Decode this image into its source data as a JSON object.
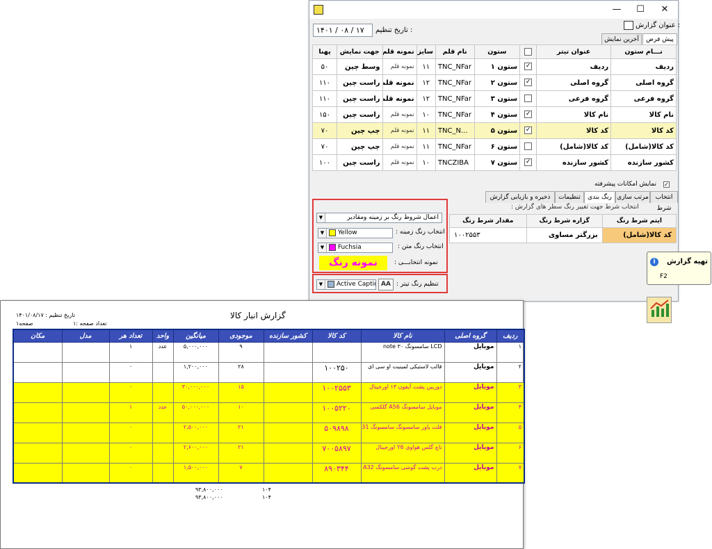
{
  "window": {
    "title": "",
    "controls": {
      "minimize": "—",
      "maximize": "☐",
      "close": "✕"
    },
    "report_title_label": "عنوان گزارش :",
    "date_label": "تاریخ تنظیم :",
    "date_day": "۱۴۰۱",
    "date_month": "/ ۰۸ /",
    "date_year": "۱۷",
    "tabs": {
      "default": "پیش فرض",
      "last": "آخرین نمایش"
    },
    "grid_headers": [
      "نـــام ستون",
      "عنوان تیتر",
      "",
      "ستون",
      "نام قلم",
      "سایز",
      "نمونه قلم",
      "جهت نمایش",
      "پهنا"
    ],
    "grid_rows": [
      {
        "name": "ردیف",
        "title": "ردیف",
        "checked": "✓",
        "col": "ستون ۱",
        "font": "TNC_NFar",
        "size": "۱۱",
        "sample": "نمونه قلم",
        "dir": "وسط چین",
        "width": "۵۰"
      },
      {
        "name": "گروه اصلی",
        "title": "گروه اصلی",
        "checked": "✓",
        "col": "ستون ۲",
        "font": "TNC_NFar",
        "size": "۱۲",
        "sample": "نمونه قلم",
        "dir": "راست چین",
        "width": "۱۱۰"
      },
      {
        "name": "گروه فرعی",
        "title": "گروه فرعی",
        "checked": "",
        "col": "ستون ۳",
        "font": "TNC_NFar",
        "size": "۱۲",
        "sample": "نمونه قلم",
        "dir": "راست چین",
        "width": "۱۱۰"
      },
      {
        "name": "نام کالا",
        "title": "نام کالا",
        "checked": "✓",
        "col": "ستون ۴",
        "font": "TNC_NFar",
        "size": "۱۰",
        "sample": "نمونه قلم",
        "dir": "راست چین",
        "width": "۱۵۰"
      },
      {
        "name": "کد کالا",
        "title": "کد کالا",
        "checked": "✓",
        "col": "ستون ۵",
        "font": "TNC_N...",
        "size": "۱۱",
        "sample": "نمونه قلم",
        "dir": "چپ چین",
        "width": "۷۰"
      },
      {
        "name": "کد کالا(شامل)",
        "title": "کد کالا(شامل)",
        "checked": "",
        "col": "ستون ۶",
        "font": "TNC_NFar",
        "size": "۱۱",
        "sample": "نمونه قلم",
        "dir": "چپ چین",
        "width": "۷۰"
      },
      {
        "name": "کشور سازنده",
        "title": "کشور سازنده",
        "checked": "✓",
        "col": "ستون ۷",
        "font": "TNCZIBA",
        "size": "۱۰",
        "sample": "نمونه قلم",
        "dir": "راست چین",
        "width": "۱۰۰"
      }
    ],
    "advanced_label": "نمایش امکانات پیشرفته",
    "lower_tabs": [
      "انتخاب شرط",
      "مرتب سازی",
      "رنگ بندی",
      "تنظیمات",
      "ذخیره و بازیابی گزارش"
    ],
    "lower_hint": "انتخاب شرط جهت تغییر رنگ سطر های گزارش :",
    "apply_combo": "اعمال شروط رنگ بر زمینه ومقادیر",
    "bg_color_label": "انتخاب رنگ زمینه :",
    "bg_color_value": "Yellow",
    "text_color_label": "انتخاب رنگ متن :",
    "text_color_value": "Fuchsia",
    "sample_label": "نمونه انتخابـــی :",
    "sample_text": "نمونه رنگ",
    "title_color_label": "تنظیم رنگ تیتر :",
    "title_color_value": "Active Captio",
    "cond_headers": [
      "ایتم شرط رنگ",
      "گزاره شرط رنگ",
      "مقدار شرط رنگ"
    ],
    "cond_row": {
      "item": "کد کالا(شامل)",
      "op": "بزرگتر مساوی",
      "value": "۱۰۰۲۵۵۳"
    },
    "tooltip_title": "تهیه گزارش",
    "tooltip_key": "F2"
  },
  "colors": {
    "highlight": "#ffff00",
    "text_fuchsia": "#d100ac",
    "header_blue": "#3a4fb7",
    "red_frame": "#e03a3a"
  },
  "report": {
    "title": "گزارش انبار کالا",
    "date": "تاریخ تنظیم : ۱۴۰۱/۰۸/۱۷",
    "page": "صفحه۱",
    "page_count": "تعداد صفحه :۱",
    "headers": [
      "ردیف",
      "گروه اصلی",
      "نام کالا",
      "کد کالا",
      "کشور سازنده",
      "موجودی",
      "میانگین",
      "واحد",
      "تعداد هر",
      "مدل",
      "مکان"
    ],
    "rows": [
      {
        "hl": false,
        "cells": [
          "۱",
          "موبایل",
          "LCD سامسونگ ۳۰ note",
          "",
          "",
          "۹",
          "۵,۰۰۰,۰۰۰",
          "عدد",
          "۱",
          "",
          ""
        ]
      },
      {
        "hl": false,
        "cells": [
          "۲",
          "موبایل",
          "قالب لاستیکی لمینیت او سی ای",
          "۱۰۰۲۵۰",
          "",
          "۲۸",
          "۱,۲۰۰,۰۰۰",
          "",
          "۰",
          "",
          ""
        ]
      },
      {
        "hl": true,
        "cells": [
          "۳",
          "موبایل",
          "دوربین پشت آیفون ۱۳ اورجینال",
          "۱۰۰۲۵۵۳",
          "",
          "۱۵",
          "۳۰,۰۰۰,۰۰۰",
          "",
          "۰",
          "",
          ""
        ]
      },
      {
        "hl": true,
        "cells": [
          "۴",
          "موبایل",
          "موبایل سامسونگ A56 گلکسی",
          "۱۰۰۵۲۲۰",
          "",
          "۱۰",
          "۵۰,۰۰۰,۰۰۰",
          "عدد",
          "۱",
          "",
          ""
        ]
      },
      {
        "hl": true,
        "cells": [
          "۵",
          "موبایل",
          "فلت پاور سامسونگ سامسونگ A31",
          "۵۰۹۸۹۸",
          "",
          "۲۱",
          "۲,۵۰۰,۰۰۰",
          "",
          "۰",
          "",
          ""
        ]
      },
      {
        "hl": true,
        "cells": [
          "۶",
          "موبایل",
          "تاچ گلس هواوی Y6 اورجینال",
          "۷۰۰۵۸۹۷",
          "",
          "۲۱",
          "۲,۶۰۰,۰۰۰",
          "",
          "۰",
          "",
          ""
        ]
      },
      {
        "hl": true,
        "cells": [
          "۷",
          "موبایل",
          "درب پشت گوشی سامسونگ A32",
          "۸۹۰۳۴۴",
          "",
          "۷",
          "۱,۵۰۰,۰۰۰",
          "",
          "۰",
          "",
          ""
        ]
      }
    ],
    "totals": [
      {
        "qty": "۱۰۴",
        "sum": "۹۳,۸۰۰,۰۰۰"
      },
      {
        "qty": "۱۰۴",
        "sum": "۹۳,۸۰۰,۰۰۰"
      }
    ]
  }
}
